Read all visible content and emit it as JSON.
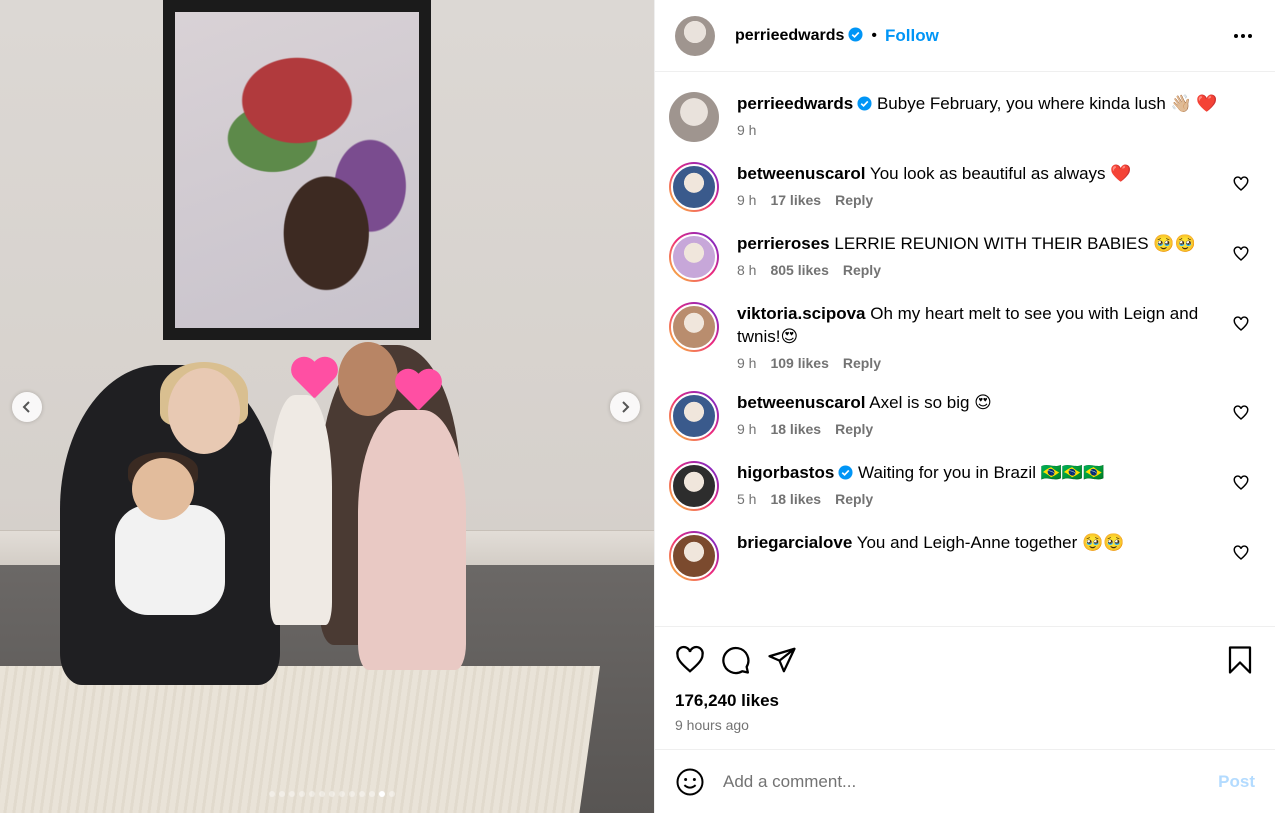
{
  "post": {
    "username": "perrieedwards",
    "verified": true,
    "separator": "•",
    "follow_label": "Follow",
    "likes": "176,240 likes",
    "time_ago": "9 hours ago"
  },
  "media": {
    "slide_count": 13,
    "active_slide": 12
  },
  "caption": {
    "username": "perrieedwards",
    "text": "Bubye February, you where kinda lush 👋🏼 ❤️",
    "time": "9 h"
  },
  "comments": [
    {
      "username": "betweenuscarol",
      "text": "You look as beautiful as always ❤️",
      "time": "9 h",
      "likes": "17 likes",
      "reply": "Reply",
      "avatar_color": "#3a5a8c"
    },
    {
      "username": "perrieroses",
      "text": "LERRIE REUNION WITH THEIR BABIES 🥹🥹",
      "time": "8 h",
      "likes": "805 likes",
      "reply": "Reply",
      "avatar_color": "#c7a7d9"
    },
    {
      "username": "viktoria.scipova",
      "text": "Oh my heart melt to see you with Leign and twnis!😍",
      "time": "9 h",
      "likes": "109 likes",
      "reply": "Reply",
      "avatar_color": "#b98d6e"
    },
    {
      "username": "betweenuscarol",
      "text": "Axel is so big 😍",
      "time": "9 h",
      "likes": "18 likes",
      "reply": "Reply",
      "avatar_color": "#3a5a8c"
    },
    {
      "username": "higorbastos",
      "verified": true,
      "text": "Waiting for you in Brazil 🇧🇷🇧🇷🇧🇷",
      "time": "5 h",
      "likes": "18 likes",
      "reply": "Reply",
      "avatar_color": "#2d2d2d"
    },
    {
      "username": "briegarcialove",
      "text": "You and Leigh-Anne together 🥹🥹",
      "time": "",
      "likes": "",
      "reply": "",
      "avatar_color": "#7b4a2e"
    }
  ],
  "add_comment": {
    "placeholder": "Add a comment...",
    "post_label": "Post"
  },
  "colors": {
    "accent": "#0095f6",
    "muted": "#737373",
    "verified": "#0095f6"
  }
}
